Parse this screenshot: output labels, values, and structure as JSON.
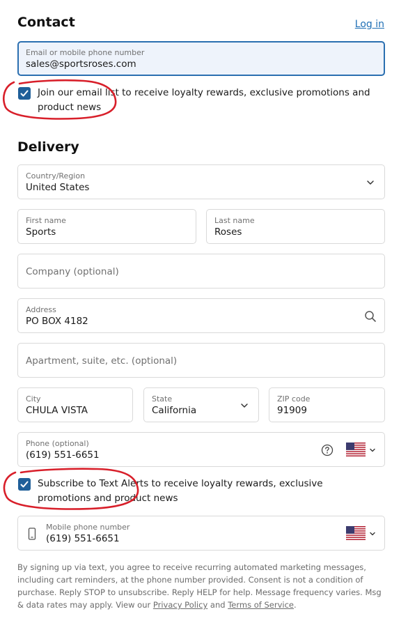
{
  "contact": {
    "title": "Contact",
    "login_label": "Log in",
    "email": {
      "label": "Email or mobile phone number",
      "value": "sales@sportsroses.com"
    },
    "email_list": {
      "checked": true,
      "text": "Join our email list to receive loyalty rewards, exclusive promotions and product news"
    }
  },
  "delivery": {
    "title": "Delivery",
    "country": {
      "label": "Country/Region",
      "value": "United States"
    },
    "first_name": {
      "label": "First name",
      "value": "Sports"
    },
    "last_name": {
      "label": "Last name",
      "value": "Roses"
    },
    "company": {
      "placeholder": "Company (optional)"
    },
    "address": {
      "label": "Address",
      "value": "PO BOX 4182"
    },
    "apartment": {
      "placeholder": "Apartment, suite, etc. (optional)"
    },
    "city": {
      "label": "City",
      "value": "CHULA VISTA"
    },
    "state": {
      "label": "State",
      "value": "California"
    },
    "zip": {
      "label": "ZIP code",
      "value": "91909"
    },
    "phone": {
      "label": "Phone (optional)",
      "value": "(619) 551-6651"
    },
    "text_alerts": {
      "checked": true,
      "text": "Subscribe to Text Alerts to receive loyalty rewards, exclusive promotions and product news"
    },
    "mobile": {
      "label": "Mobile phone number",
      "value": "(619) 551-6651"
    }
  },
  "disclaimer": {
    "text": "By signing up via text, you agree to receive recurring automated marketing messages, including cart reminders, at the phone number provided. Consent is not a condition of purchase. Reply STOP to unsubscribe. Reply HELP for help. Message frequency varies. Msg & data rates may apply. View our ",
    "privacy_label": "Privacy Policy",
    "and_text": " and ",
    "terms_label": "Terms of Service",
    "end_text": "."
  },
  "colors": {
    "accent": "#1f5f99",
    "link": "#1f6fb5",
    "annotation": "#d81f2a",
    "focus_border": "#2a6fb0"
  },
  "icons": [
    "check-icon",
    "chevron-down-icon",
    "search-icon",
    "help-circle-icon",
    "us-flag-icon",
    "mobile-phone-icon"
  ]
}
